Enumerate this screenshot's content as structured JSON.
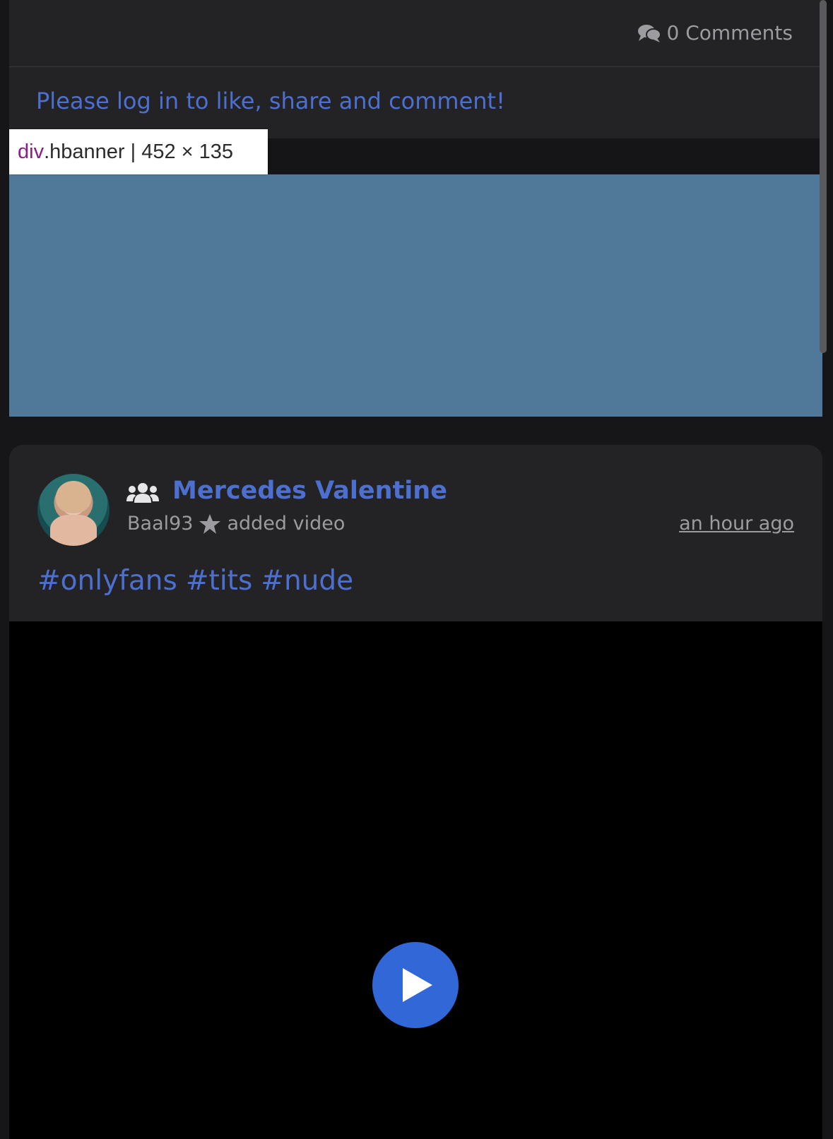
{
  "previous_post": {
    "comments_label": "0 Comments",
    "login_prompt": "Please log in to like, share and comment!"
  },
  "devtools": {
    "tag_name": "div",
    "class_and_size": ".hbanner | 452 × 135"
  },
  "post": {
    "group_name": "Mercedes Valentine",
    "author": "Baal93",
    "action": "added video",
    "timestamp": "an hour ago",
    "hashtags": [
      "#onlyfans",
      "#tits",
      "#nude"
    ]
  },
  "colors": {
    "background": "#161618",
    "card": "#232325",
    "accent_link": "#4d6fcf",
    "muted_text": "#9b9ba0",
    "banner_highlight": "#507898",
    "play_button": "#3167d7"
  },
  "icons": {
    "comments": "comments-icon",
    "group": "users-icon",
    "star": "star-icon",
    "play": "play-icon"
  }
}
